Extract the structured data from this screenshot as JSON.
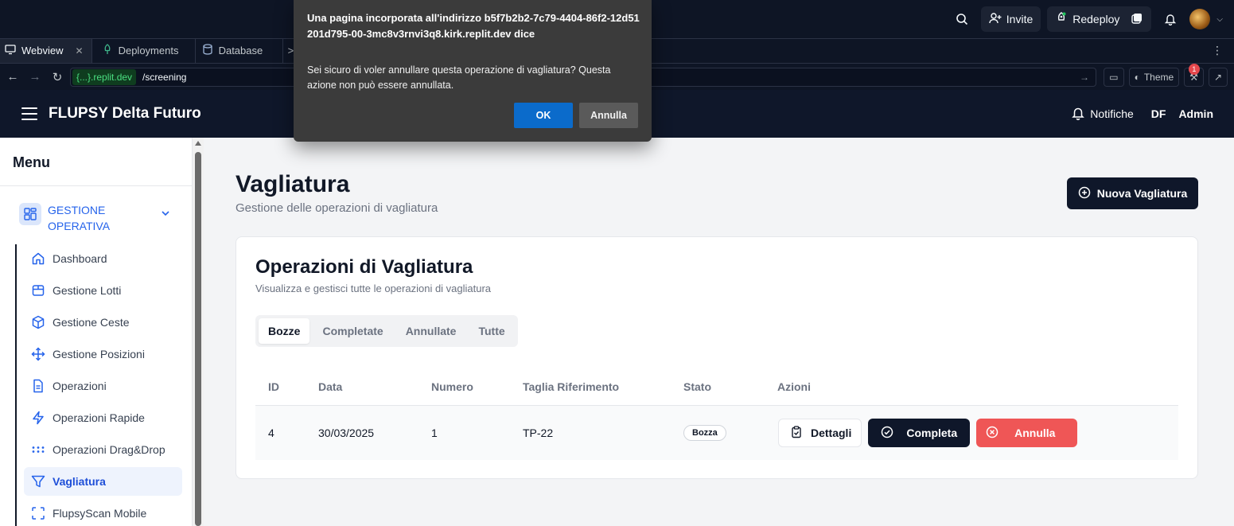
{
  "replit": {
    "invite_label": "Invite",
    "redeploy_label": "Redeploy",
    "tabs": [
      {
        "label": "Webview",
        "icon": "monitor-icon"
      },
      {
        "label": "Deployments",
        "icon": "deploy-icon"
      },
      {
        "label": "Database",
        "icon": "database-icon"
      }
    ],
    "url_domain": "{...}.replit.dev",
    "url_path": "/screening",
    "theme_label": "Theme",
    "devtools_badge": "1"
  },
  "dialog": {
    "title": "Una pagina incorporata all'indirizzo b5f7b2b2-7c79-4404-86f2-12d51201d795-00-3mc8v3rnvi3q8.kirk.replit.dev dice",
    "message": "Sei sicuro di voler annullare questa operazione di vagliatura? Questa azione non può essere annullata.",
    "ok_label": "OK",
    "cancel_label": "Annulla"
  },
  "header": {
    "title": "FLUPSY Delta Futuro",
    "notifications_label": "Notifiche",
    "user_initials": "DF",
    "user_name": "Admin"
  },
  "sidebar": {
    "title": "Menu",
    "group_label": "GESTIONE OPERATIVA",
    "items": [
      {
        "label": "Dashboard",
        "icon": "home-icon",
        "active": false
      },
      {
        "label": "Gestione Lotti",
        "icon": "package-icon",
        "active": false
      },
      {
        "label": "Gestione Ceste",
        "icon": "box-icon",
        "active": false
      },
      {
        "label": "Gestione Posizioni",
        "icon": "move-icon",
        "active": false
      },
      {
        "label": "Operazioni",
        "icon": "file-text-icon",
        "active": false
      },
      {
        "label": "Operazioni Rapide",
        "icon": "zap-icon",
        "active": false
      },
      {
        "label": "Operazioni Drag&Drop",
        "icon": "grip-icon",
        "active": false
      },
      {
        "label": "Vagliatura",
        "icon": "filter-icon",
        "active": true
      },
      {
        "label": "FlupsyScan Mobile",
        "icon": "scan-icon",
        "active": false
      }
    ]
  },
  "main": {
    "title": "Vagliatura",
    "subtitle": "Gestione delle operazioni di vagliatura",
    "new_button_label": "Nuova Vagliatura",
    "card": {
      "title": "Operazioni di Vagliatura",
      "subtitle": "Visualizza e gestisci tutte le operazioni di vagliatura",
      "tabs": [
        "Bozze",
        "Completate",
        "Annullate",
        "Tutte"
      ],
      "active_tab": "Bozze",
      "columns": [
        "ID",
        "Data",
        "Numero",
        "Taglia Riferimento",
        "Stato",
        "Azioni"
      ],
      "rows": [
        {
          "id": "4",
          "data": "30/03/2025",
          "numero": "1",
          "taglia": "TP-22",
          "stato": "Bozza"
        }
      ],
      "actions": {
        "details": "Dettagli",
        "complete": "Completa",
        "cancel": "Annulla"
      }
    }
  },
  "colors": {
    "accent_blue": "#2563eb",
    "dark_navy": "#0f172a",
    "danger": "#ef5656",
    "dialog_ok": "#0b6bcb"
  }
}
